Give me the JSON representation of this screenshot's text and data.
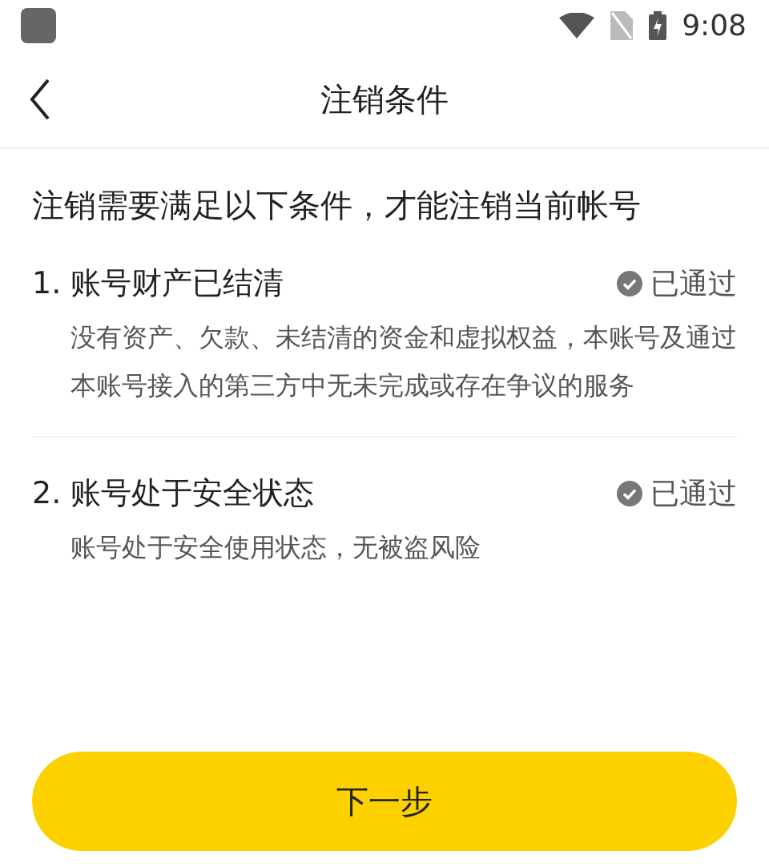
{
  "status_bar": {
    "time": "9:08"
  },
  "header": {
    "title": "注销条件"
  },
  "intro": "注销需要满足以下条件，才能注销当前帐号",
  "conditions": [
    {
      "title": "1. 账号财产已结清",
      "status": "已通过",
      "description": "没有资产、欠款、未结清的资金和虚拟权益，本账号及通过本账号接入的第三方中无未完成或存在争议的服务"
    },
    {
      "title": "2. 账号处于安全状态",
      "status": "已通过",
      "description": "账号处于安全使用状态，无被盗风险"
    }
  ],
  "next_button": "下一步"
}
